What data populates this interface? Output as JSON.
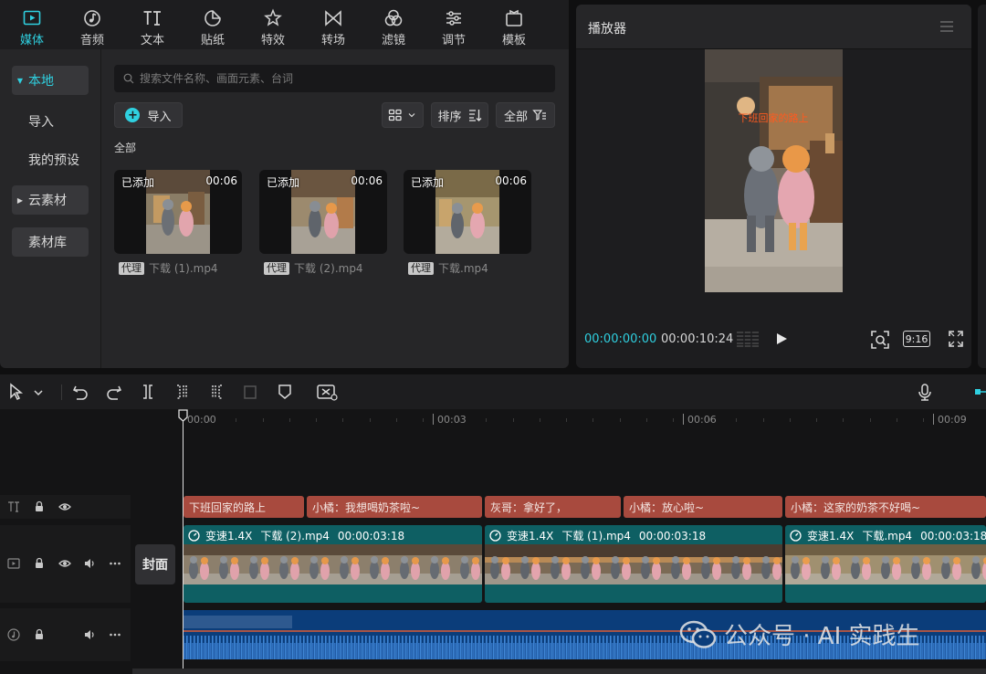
{
  "top_tabs": [
    {
      "label": "媒体",
      "icon": "media-icon",
      "active": true
    },
    {
      "label": "音频",
      "icon": "audio-icon"
    },
    {
      "label": "文本",
      "icon": "text-icon"
    },
    {
      "label": "贴纸",
      "icon": "sticker-icon"
    },
    {
      "label": "特效",
      "icon": "effects-icon"
    },
    {
      "label": "转场",
      "icon": "transition-icon"
    },
    {
      "label": "滤镜",
      "icon": "filter-icon"
    },
    {
      "label": "调节",
      "icon": "adjust-icon"
    },
    {
      "label": "模板",
      "icon": "template-icon"
    }
  ],
  "sidebar": {
    "items": [
      "本地",
      "导入",
      "我的预设",
      "云素材",
      "素材库"
    ]
  },
  "search": {
    "placeholder": "搜索文件名称、画面元素、台词"
  },
  "toolbar": {
    "import_label": "导入",
    "sort_label": "排序",
    "filter_label": "全部"
  },
  "section_label": "全部",
  "clips": [
    {
      "added": "已添加",
      "duration": "00:06",
      "tag": "代理",
      "name": "下载 (1).mp4"
    },
    {
      "added": "已添加",
      "duration": "00:06",
      "tag": "代理",
      "name": "下载 (2).mp4"
    },
    {
      "added": "已添加",
      "duration": "00:06",
      "tag": "代理",
      "name": "下载.mp4"
    }
  ],
  "player": {
    "title": "播放器",
    "preview_caption": "下班回家的路上",
    "current_time": "00:00:00:00",
    "total_time": "00:00:10:24",
    "ratio": "9:16"
  },
  "timeline": {
    "ruler": [
      "00:00",
      "00:03",
      "00:06",
      "00:09"
    ],
    "cover_label": "封面",
    "subtitles": [
      "下班回家的路上",
      "小橘：我想喝奶茶啦~",
      "灰哥：拿好了，",
      "小橘：放心啦~",
      "小橘：这家的奶茶不好喝~"
    ],
    "video_clips": [
      {
        "speed": "变速1.4X",
        "name": "下载 (2).mp4",
        "duration": "00:00:03:18"
      },
      {
        "speed": "变速1.4X",
        "name": "下载 (1).mp4",
        "duration": "00:00:03:18"
      },
      {
        "speed": "变速1.4X",
        "name": "下载.mp4",
        "duration": "00:00:03:18"
      }
    ]
  },
  "watermark": "公众号 · AI 实践生",
  "colors": {
    "accent": "#2fd0e0",
    "subtitle_clip": "#a84a3e",
    "video_clip": "#0e5f63",
    "audio_clip": "#0b3d7a"
  }
}
